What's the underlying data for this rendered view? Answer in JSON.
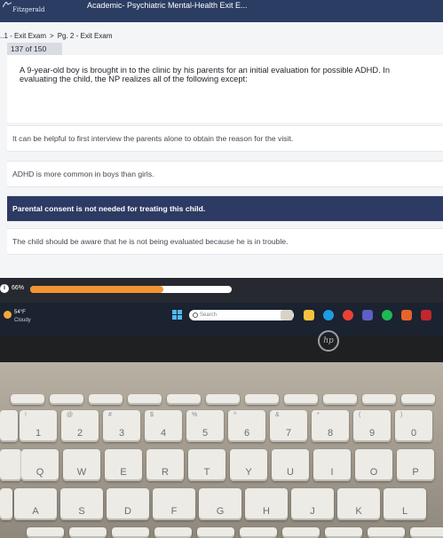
{
  "header": {
    "logo_text": "Fitzgerald",
    "title": "Academic- Psychiatric Mental-Health Exit E..."
  },
  "breadcrumb": {
    "items": [
      "..1 - Exit Exam",
      "Pg. 2 - Exit Exam"
    ],
    "separator": ">"
  },
  "question": {
    "progress_label": "137 of 150",
    "text": "A 9-year-old boy is brought in to the clinic by his parents for an initial evaluation for possible ADHD. In evaluating the child, the NP realizes all of the following except:"
  },
  "options": [
    {
      "text": "It can be helpful to first interview the parents alone to obtain the reason for the visit.",
      "selected": false
    },
    {
      "text": "ADHD is more common in boys than girls.",
      "selected": false
    },
    {
      "text": "Parental consent is not needed for treating this child.",
      "selected": true
    },
    {
      "text": "The child should be aware that he is not being evaluated because he is in trouble.",
      "selected": false
    }
  ],
  "progress": {
    "percent_label": "66%",
    "fraction": 0.66,
    "icon": "info-icon"
  },
  "taskbar": {
    "weather_temp": "54°F",
    "weather_condition": "Cloudy",
    "search_placeholder": "Search",
    "icons": [
      "windows-start-icon",
      "search-icon",
      "widgets-icon",
      "file-explorer-icon",
      "edge-browser-icon",
      "chrome-icon",
      "teams-icon",
      "spotify-icon",
      "office-icon",
      "security-icon"
    ]
  },
  "laptop": {
    "brand_logo": "hp"
  },
  "keyboard": {
    "number_row": [
      {
        "main": "1",
        "sub": "!"
      },
      {
        "main": "2",
        "sub": "@"
      },
      {
        "main": "3",
        "sub": "#"
      },
      {
        "main": "4",
        "sub": "$"
      },
      {
        "main": "5",
        "sub": "%"
      },
      {
        "main": "6",
        "sub": "^"
      },
      {
        "main": "7",
        "sub": "&"
      },
      {
        "main": "8",
        "sub": "*"
      },
      {
        "main": "9",
        "sub": "("
      },
      {
        "main": "0",
        "sub": ")"
      }
    ],
    "row_qwerty": [
      "Q",
      "W",
      "E",
      "R",
      "T",
      "Y",
      "U",
      "I",
      "O",
      "P"
    ],
    "row_asdf": [
      "A",
      "S",
      "D",
      "F",
      "G",
      "H",
      "J",
      "K",
      "L"
    ]
  },
  "colors": {
    "header_bg": "#2b3d63",
    "selected_option_bg": "#2d3a63",
    "progress_fill": "#f29431",
    "taskbar_bg": "#1b2230"
  }
}
